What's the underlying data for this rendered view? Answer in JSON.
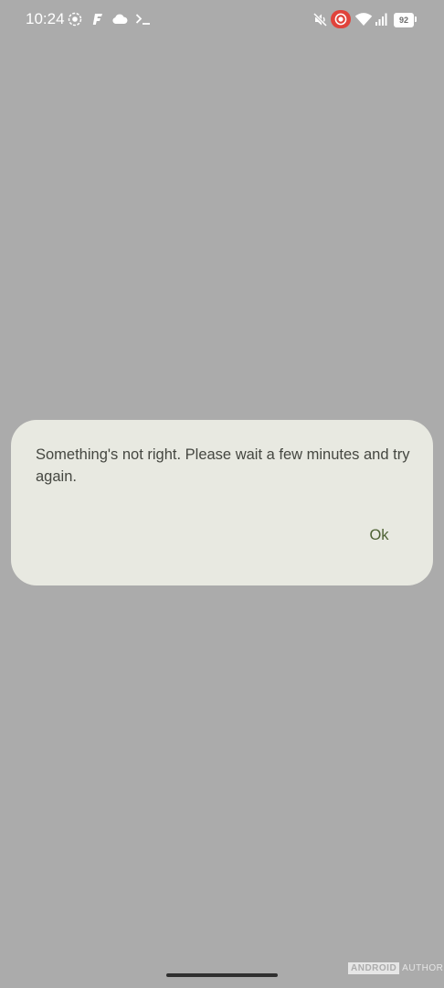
{
  "status_bar": {
    "time": "10:24",
    "battery": "92",
    "icons_left": [
      "screen-record-icon",
      "fdroid-icon",
      "cloud-icon",
      "terminal-icon"
    ],
    "icons_right": [
      "mute-icon",
      "recording-icon",
      "wifi-icon",
      "signal-icon",
      "battery-icon"
    ]
  },
  "dialog": {
    "message": "Something's not right. Please wait a few minutes and try again.",
    "ok_label": "Ok"
  },
  "watermark": {
    "part1": "ANDROID",
    "part2": "AUTHORITY"
  },
  "colors": {
    "background": "#ababab",
    "dialog_surface": "#e8e9e1",
    "accent": "#4d6133",
    "text": "#454741",
    "record_red": "#e0433b"
  }
}
